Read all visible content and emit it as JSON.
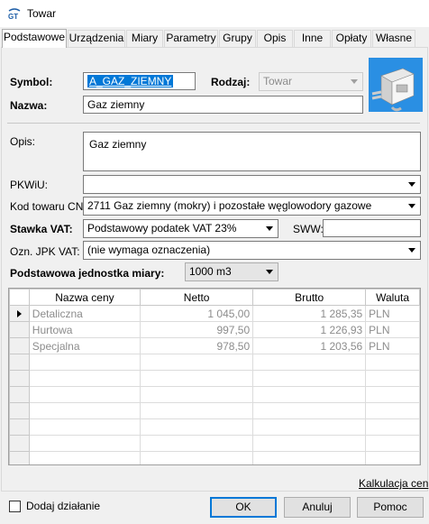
{
  "window": {
    "title": "Towar"
  },
  "tabs": [
    {
      "label": "Podstawowe",
      "active": true
    },
    {
      "label": "Urządzenia"
    },
    {
      "label": "Miary"
    },
    {
      "label": "Parametry"
    },
    {
      "label": "Grupy"
    },
    {
      "label": "Opis"
    },
    {
      "label": "Inne"
    },
    {
      "label": "Opłaty"
    },
    {
      "label": "Własne"
    }
  ],
  "form": {
    "symbol_label": "Symbol:",
    "symbol_value": "A_GAZ_ZIEMNY",
    "rodzaj_label": "Rodzaj:",
    "rodzaj_value": "Towar",
    "nazwa_label": "Nazwa:",
    "nazwa_value": "Gaz ziemny",
    "opis_label": "Opis:",
    "opis_value": "Gaz ziemny",
    "pkwiu_label": "PKWiU:",
    "pkwiu_value": "",
    "kod_cn_label": "Kod towaru CN:",
    "kod_cn_value": "2711 Gaz ziemny (mokry) i pozostałe węglowodory gazowe",
    "stawka_vat_label": "Stawka VAT:",
    "stawka_vat_value": "Podstawowy podatek VAT 23%",
    "sww_label": "SWW:",
    "sww_value": "",
    "jpk_label": "Ozn. JPK VAT:",
    "jpk_value": "(nie wymaga oznaczenia)",
    "jednostka_label": "Podstawowa jednostka miary:",
    "jednostka_value": "1000 m3"
  },
  "price_table": {
    "headers": [
      "Nazwa ceny",
      "Netto",
      "Brutto",
      "Waluta"
    ],
    "rows": [
      {
        "name": "Detaliczna",
        "netto": "1 045,00",
        "brutto": "1 285,35",
        "waluta": "PLN",
        "current": true
      },
      {
        "name": "Hurtowa",
        "netto": "997,50",
        "brutto": "1 226,93",
        "waluta": "PLN"
      },
      {
        "name": "Specjalna",
        "netto": "978,50",
        "brutto": "1 203,56",
        "waluta": "PLN"
      }
    ],
    "empty_rows": 7
  },
  "links": {
    "kalkulacja": "Kalkulacja cen"
  },
  "footer": {
    "dodaj_dzialanie": "Dodaj działanie",
    "ok": "OK",
    "anuluj": "Anuluj",
    "pomoc": "Pomoc"
  },
  "icons": {
    "app": "gt-logo-icon",
    "product": "gas-meter-product-image",
    "dropdown": "chevron-down-icon",
    "row_indicator": "row-pointer-icon"
  },
  "colors": {
    "selection": "#0078d7",
    "disabled_text": "#8c8c8c"
  }
}
